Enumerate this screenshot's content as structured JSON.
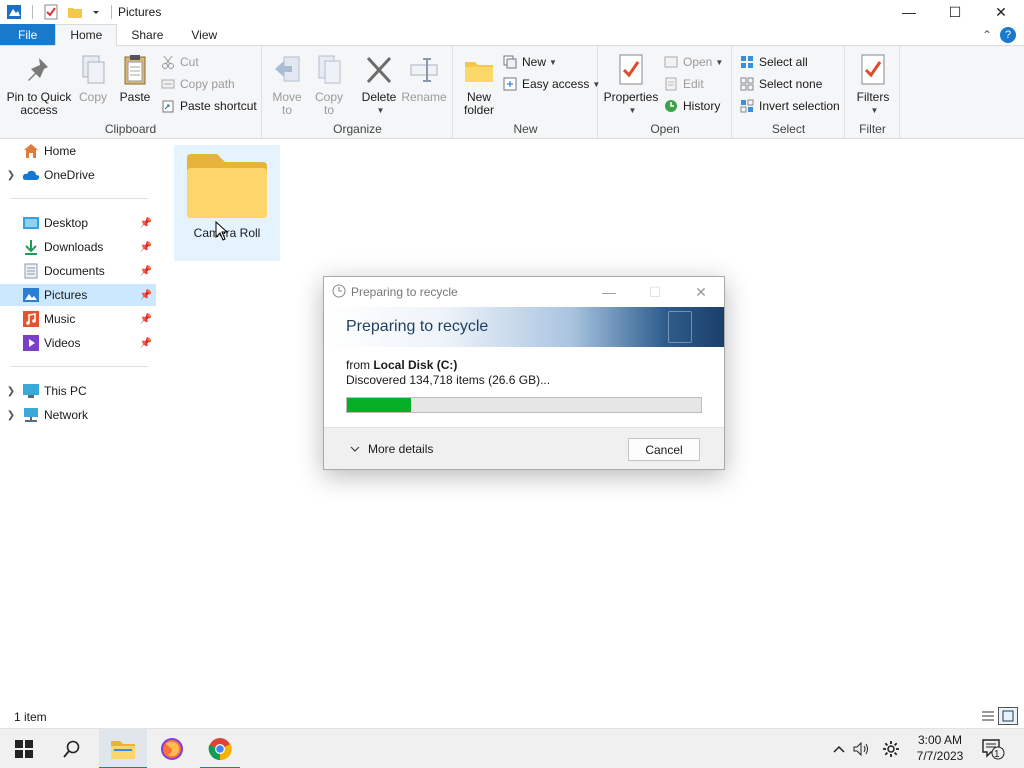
{
  "window": {
    "title": "Pictures",
    "controls": {
      "minimize": "—",
      "maximize": "☐",
      "close": "✕"
    }
  },
  "ribbon_tabs": [
    "File",
    "Home",
    "Share",
    "View"
  ],
  "ribbon_right": {
    "collapse": "⌃",
    "help": "?"
  },
  "ribbon": {
    "clipboard": {
      "label": "Clipboard",
      "pin": "Pin to Quick access",
      "pin_l1": "Pin to Quick",
      "pin_l2": "access",
      "copy": "Copy",
      "paste": "Paste",
      "cut": "Cut",
      "copy_path": "Copy path",
      "paste_shortcut": "Paste shortcut"
    },
    "organize": {
      "label": "Organize",
      "move_l1": "Move",
      "move_l2": "to",
      "copy_l1": "Copy",
      "copy_l2": "to",
      "delete": "Delete",
      "rename": "Rename"
    },
    "new": {
      "label": "New",
      "folder_l1": "New",
      "folder_l2": "folder",
      "new_item": "New",
      "easy_access": "Easy access"
    },
    "open": {
      "label": "Open",
      "properties": "Properties",
      "open": "Open",
      "edit": "Edit",
      "history": "History"
    },
    "select": {
      "label": "Select",
      "select_all": "Select all",
      "select_none": "Select none",
      "invert": "Invert selection"
    },
    "filter": {
      "label": "Filter",
      "filters": "Filters"
    }
  },
  "nav": {
    "home": "Home",
    "onedrive": "OneDrive",
    "desktop": "Desktop",
    "downloads": "Downloads",
    "documents": "Documents",
    "pictures": "Pictures",
    "music": "Music",
    "videos": "Videos",
    "thispc": "This PC",
    "network": "Network"
  },
  "content": {
    "folder_name": "Camera Roll"
  },
  "status": {
    "count": "1 item"
  },
  "dialog": {
    "title": "Preparing to recycle",
    "heading": "Preparing to recycle",
    "from_prefix": "from",
    "from_location": "Local Disk (C:)",
    "discovered": "Discovered 134,718 items (26.6 GB)...",
    "progress": 0.18,
    "more_details": "More details",
    "cancel": "Cancel"
  },
  "taskbar": {
    "time": "3:00 AM",
    "date": "7/7/2023",
    "notification_count": "1"
  },
  "colors": {
    "accent": "#1979ca",
    "progress_green": "#06b025",
    "selection": "#cce8ff"
  }
}
